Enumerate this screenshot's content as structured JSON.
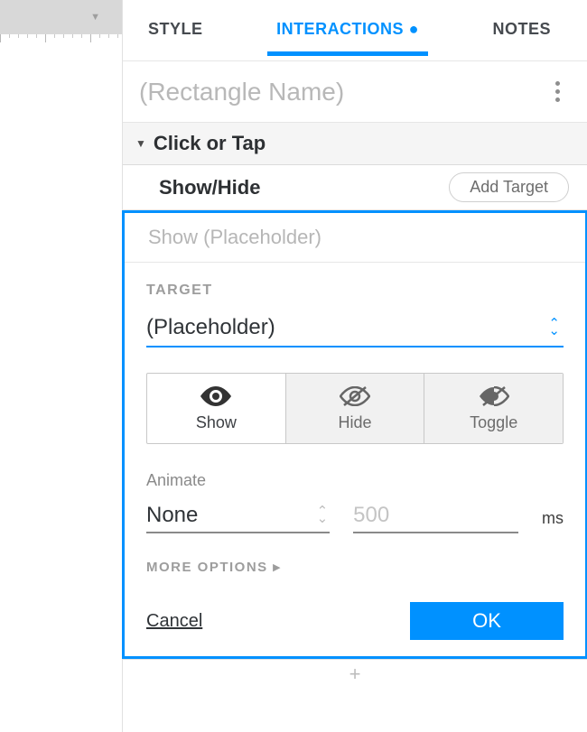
{
  "tabs": {
    "style": "STYLE",
    "interactions": "INTERACTIONS",
    "notes": "NOTES"
  },
  "widget_name_placeholder": "(Rectangle Name)",
  "event": {
    "label": "Click or Tap"
  },
  "action": {
    "label": "Show/Hide",
    "add_target": "Add Target"
  },
  "summary": "Show (Placeholder)",
  "target": {
    "label": "TARGET",
    "value": "(Placeholder)"
  },
  "visibility": {
    "options": [
      "Show",
      "Hide",
      "Toggle"
    ],
    "selected": "Show"
  },
  "animate": {
    "label": "Animate",
    "value": "None",
    "duration_placeholder": "500",
    "unit": "ms"
  },
  "more_options": "MORE OPTIONS",
  "buttons": {
    "cancel": "Cancel",
    "ok": "OK"
  },
  "footer_add": "+"
}
